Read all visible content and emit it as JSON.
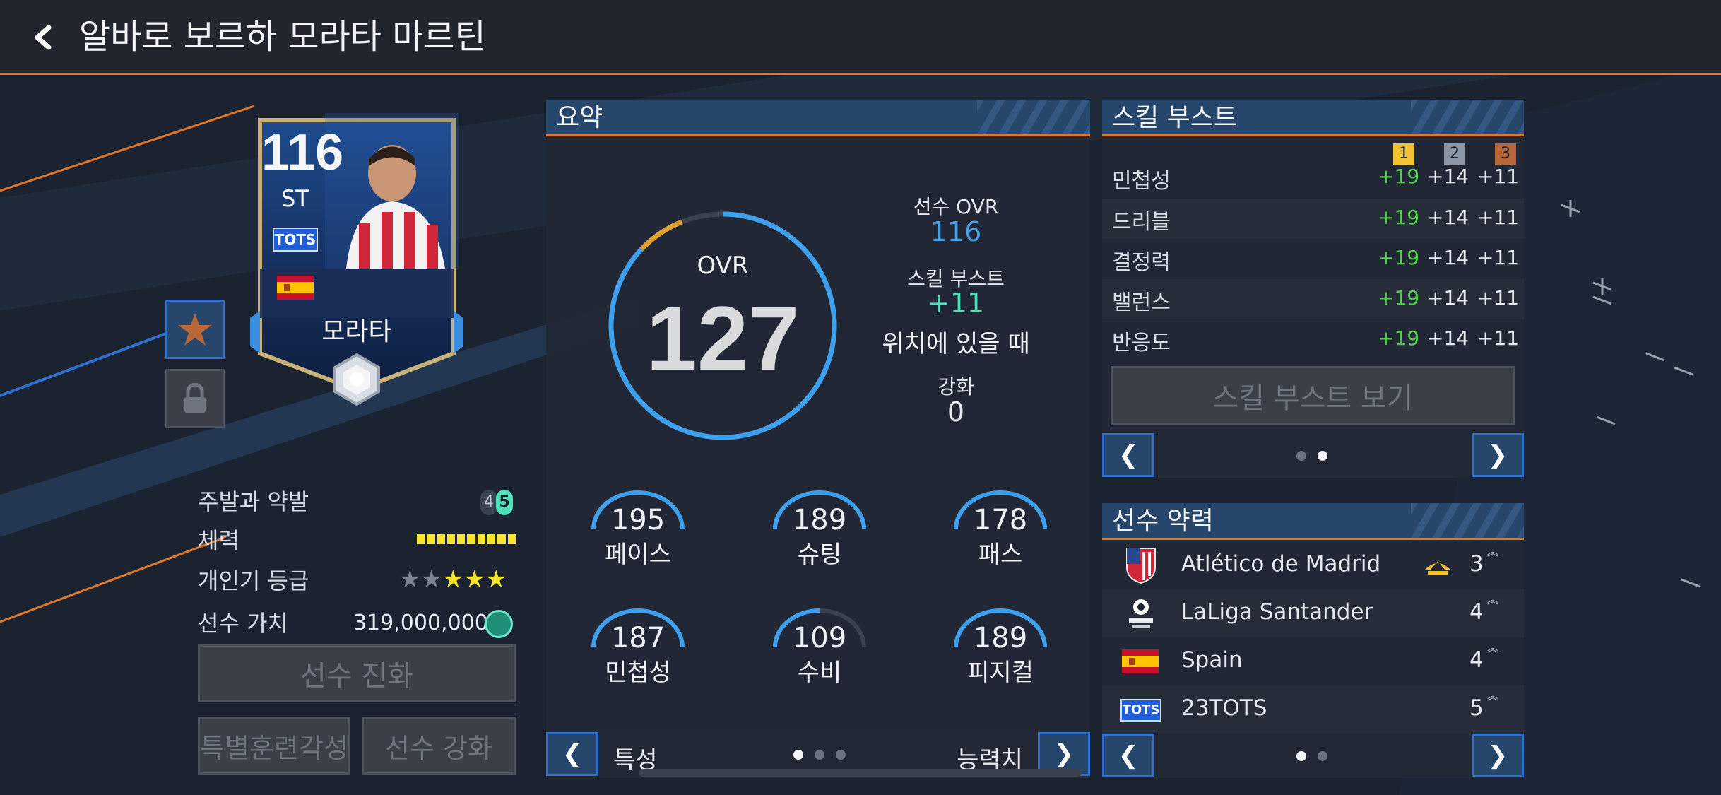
{
  "header": {
    "title": "알바로 보르하 모라타 마르틴"
  },
  "card": {
    "ovr": "116",
    "position": "ST",
    "badge": "TOTS",
    "name": "모라타"
  },
  "player_info": {
    "foot_label": "주발과 약발",
    "foot_strong": "4",
    "foot_weak": "5",
    "stamina_label": "체력",
    "stamina_level": 1.0,
    "popularity_label": "개인기 등급",
    "popularity_stars": 5,
    "popularity_filled": 3,
    "value_label": "선수 가치",
    "value": "319,000,000"
  },
  "buttons": {
    "evolve": "선수 진화",
    "special": "특별훈련각성",
    "enhance": "선수 강화",
    "view_boost": "스킬 부스트 보기"
  },
  "summary": {
    "title": "요약",
    "ovr_label": "OVR",
    "ovr_value": "127",
    "ovr_fraction": 0.9,
    "player_ovr_label": "선수 OVR",
    "player_ovr": "116",
    "boost_label": "스킬 부스트",
    "boost_value": "+11",
    "boost_sub": "위치에 있을 때",
    "enhance_label": "강화",
    "enhance_value": "0",
    "stats": [
      {
        "label": "페이스",
        "value": "195"
      },
      {
        "label": "슈팅",
        "value": "189"
      },
      {
        "label": "패스",
        "value": "178"
      },
      {
        "label": "민첩성",
        "value": "187"
      },
      {
        "label": "수비",
        "value": "109"
      },
      {
        "label": "피지컬",
        "value": "189"
      }
    ],
    "nav_left": "특성",
    "nav_right": "능력치"
  },
  "skill_boost": {
    "title": "스킬 부스트",
    "columns": [
      "1",
      "2",
      "3"
    ],
    "column_colors": [
      "#f2c230",
      "#8c95a6",
      "#b8673a"
    ],
    "rows": [
      {
        "name": "민첩성",
        "v1": "+19",
        "v2": "+14",
        "v3": "+11"
      },
      {
        "name": "드리블",
        "v1": "+19",
        "v2": "+14",
        "v3": "+11"
      },
      {
        "name": "결정력",
        "v1": "+19",
        "v2": "+14",
        "v3": "+11"
      },
      {
        "name": "밸런스",
        "v1": "+19",
        "v2": "+14",
        "v3": "+11"
      },
      {
        "name": "반응도",
        "v1": "+19",
        "v2": "+14",
        "v3": "+11"
      }
    ]
  },
  "chemistry": {
    "title": "선수 약력",
    "rows": [
      {
        "name": "Atlético de Madrid",
        "level": "3"
      },
      {
        "name": "LaLiga Santander",
        "level": "4"
      },
      {
        "name": "Spain",
        "level": "4"
      },
      {
        "name": "23TOTS",
        "level": "5",
        "badge": "TOTS"
      }
    ]
  },
  "icons": {
    "back": "chevron-left-icon",
    "favorite": "star-icon",
    "lock": "lock-icon",
    "coin": "coin-icon"
  },
  "colors": {
    "accent": "#e0782a",
    "panel_header": "#26466c",
    "nav_border": "#2f6fd0",
    "green": "#4fd24a",
    "teal": "#4fe0b8",
    "blue_value": "#4aa3e8"
  }
}
